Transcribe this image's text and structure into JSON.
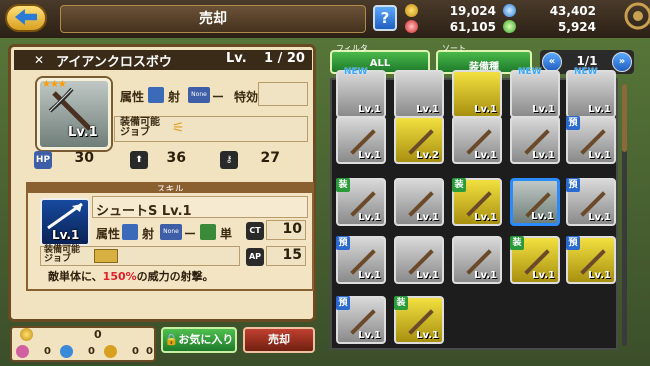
{
  "header": {
    "title": "売却",
    "help_label": "?",
    "gold": "19,024",
    "crystal": "43,402",
    "gems": "61,105",
    "stamina": "5,924"
  },
  "item": {
    "name": "アイアンクロスボウ",
    "level_label": "Lv.",
    "level_value": "1 / 20",
    "icon_level": "Lv.1",
    "attr_label": "属性",
    "attr_type": "射",
    "attr_none": "None",
    "attr_none_value": "ー",
    "special_label": "特効",
    "job_label": "装備可能\nジョブ",
    "hp_label": "HP",
    "hp": "30",
    "atk": "36",
    "def": "27"
  },
  "skill": {
    "header": "スキル",
    "name": "シュートS Lv.1",
    "icon_level": "Lv.1",
    "attr_label": "属性",
    "attr_type": "射",
    "attr_none": "None",
    "attr_none_value": "ー",
    "target_type": "単",
    "ct_label": "CT",
    "ct": "10",
    "ap_label": "AP",
    "ap": "15",
    "job_label": "装備可能\nジョブ",
    "desc_prefix": "敵単体に、",
    "desc_highlight": "150%",
    "desc_suffix": "の威力の射撃。"
  },
  "resources": {
    "r1": "0",
    "r2": "0",
    "r3": "0",
    "r4": "0",
    "r5": "0"
  },
  "buttons": {
    "favorite": "お気に入り",
    "sell": "売却"
  },
  "filter": {
    "header": "フィルタ",
    "value": "ALL"
  },
  "sort": {
    "header": "ソート",
    "value": "装備種"
  },
  "pager": {
    "text": "1/1"
  },
  "grid": {
    "new_tag": "NEW",
    "equipped_tag": "装",
    "preset_tag": "預",
    "cells": [
      {
        "lv": "Lv.1"
      },
      {
        "lv": "Lv.1"
      },
      {
        "lv": "Lv.1"
      },
      {
        "lv": "Lv.1"
      },
      {
        "lv": "Lv.1"
      },
      {
        "lv": "Lv.1"
      },
      {
        "lv": "Lv.2"
      },
      {
        "lv": "Lv.1"
      },
      {
        "lv": "Lv.1"
      },
      {
        "lv": "Lv.1"
      },
      {
        "lv": "Lv.1"
      },
      {
        "lv": "Lv.1"
      },
      {
        "lv": "Lv.1"
      },
      {
        "lv": "Lv.1"
      },
      {
        "lv": "Lv.1"
      },
      {
        "lv": "Lv.1"
      },
      {
        "lv": "Lv.1"
      },
      {
        "lv": "Lv.1"
      },
      {
        "lv": "Lv.1"
      },
      {
        "lv": "Lv.1"
      },
      {
        "lv": "Lv.1"
      },
      {
        "lv": "Lv.1"
      }
    ]
  }
}
